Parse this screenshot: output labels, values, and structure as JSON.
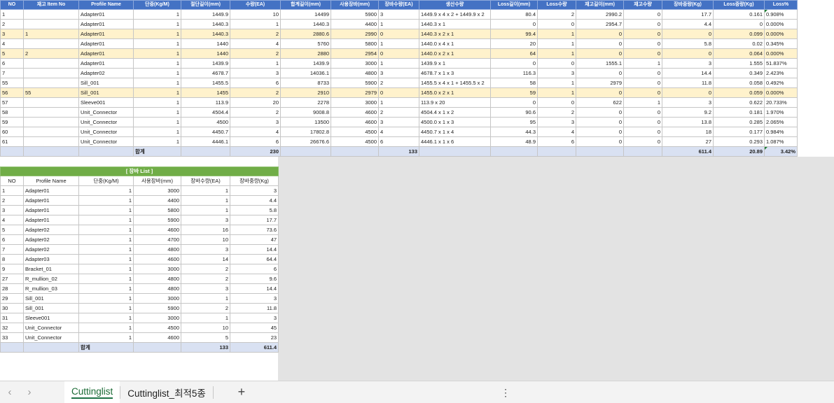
{
  "main_table": {
    "headers": [
      "NO",
      "재고 Item No",
      "Profile Name",
      "단중(Kg/M)",
      "절단길이(mm)",
      "수량(EA)",
      "합계길이(mm)",
      "사용장바(mm)",
      "장바수량(EA)",
      "생산수량",
      "Loss길이(mm)",
      "Loss수량",
      "재고길이(mm)",
      "재고수량",
      "장바중량(Kg)",
      "Loss중량(Kg)",
      "Loss%"
    ],
    "rows": [
      {
        "no": "1",
        "item": "",
        "profile": "Adapter01",
        "unit": "1",
        "cut": "1449.9",
        "qty": "10",
        "sum": "14499",
        "bar": "5900",
        "barqty": "3",
        "prod": "1449.9 x 4 x 2  +  1449.9 x 2",
        "loss": "80.4",
        "lossqty": "2",
        "stock": "2990.2",
        "stockqty": "0",
        "barw": "17.7",
        "lossw": "0.161",
        "pct": "0.908%",
        "hl": false
      },
      {
        "no": "2",
        "item": "",
        "profile": "Adapter01",
        "unit": "1",
        "cut": "1440.3",
        "qty": "1",
        "sum": "1440.3",
        "bar": "4400",
        "barqty": "1",
        "prod": "1440.3 x 1",
        "loss": "0",
        "lossqty": "0",
        "stock": "2954.7",
        "stockqty": "0",
        "barw": "4.4",
        "lossw": "0",
        "pct": "0.000%",
        "hl": false
      },
      {
        "no": "3",
        "item": "1",
        "profile": "Adapter01",
        "unit": "1",
        "cut": "1440.3",
        "qty": "2",
        "sum": "2880.6",
        "bar": "2990",
        "barqty": "0",
        "prod": "1440.3 x 2 x 1",
        "loss": "99.4",
        "lossqty": "1",
        "stock": "0",
        "stockqty": "0",
        "barw": "0",
        "lossw": "0.099",
        "pct": "0.000%",
        "hl": true
      },
      {
        "no": "4",
        "item": "",
        "profile": "Adapter01",
        "unit": "1",
        "cut": "1440",
        "qty": "4",
        "sum": "5760",
        "bar": "5800",
        "barqty": "1",
        "prod": "1440.0 x 4 x 1",
        "loss": "20",
        "lossqty": "1",
        "stock": "0",
        "stockqty": "0",
        "barw": "5.8",
        "lossw": "0.02",
        "pct": "0.345%",
        "hl": false
      },
      {
        "no": "5",
        "item": "2",
        "profile": "Adapter01",
        "unit": "1",
        "cut": "1440",
        "qty": "2",
        "sum": "2880",
        "bar": "2954",
        "barqty": "0",
        "prod": "1440.0 x 2 x 1",
        "loss": "64",
        "lossqty": "1",
        "stock": "0",
        "stockqty": "0",
        "barw": "0",
        "lossw": "0.064",
        "pct": "0.000%",
        "hl": true
      },
      {
        "no": "6",
        "item": "",
        "profile": "Adapter01",
        "unit": "1",
        "cut": "1439.9",
        "qty": "1",
        "sum": "1439.9",
        "bar": "3000",
        "barqty": "1",
        "prod": "1439.9 x 1",
        "loss": "0",
        "lossqty": "0",
        "stock": "1555.1",
        "stockqty": "1",
        "barw": "3",
        "lossw": "1.555",
        "pct": "51.837%",
        "hl": false
      },
      {
        "no": "7",
        "item": "",
        "profile": "Adapter02",
        "unit": "1",
        "cut": "4678.7",
        "qty": "3",
        "sum": "14036.1",
        "bar": "4800",
        "barqty": "3",
        "prod": "4678.7 x 1 x 3",
        "loss": "116.3",
        "lossqty": "3",
        "stock": "0",
        "stockqty": "0",
        "barw": "14.4",
        "lossw": "0.349",
        "pct": "2.423%",
        "hl": false
      },
      {
        "no": "55",
        "item": "",
        "profile": "Sill_001",
        "unit": "1",
        "cut": "1455.5",
        "qty": "6",
        "sum": "8733",
        "bar": "5900",
        "barqty": "2",
        "prod": "1455.5 x 4 x 1  +  1455.5 x 2",
        "loss": "58",
        "lossqty": "1",
        "stock": "2979",
        "stockqty": "0",
        "barw": "11.8",
        "lossw": "0.058",
        "pct": "0.492%",
        "hl": false
      },
      {
        "no": "56",
        "item": "55",
        "profile": "Sill_001",
        "unit": "1",
        "cut": "1455",
        "qty": "2",
        "sum": "2910",
        "bar": "2979",
        "barqty": "0",
        "prod": "1455.0 x 2 x 1",
        "loss": "59",
        "lossqty": "1",
        "stock": "0",
        "stockqty": "0",
        "barw": "0",
        "lossw": "0.059",
        "pct": "0.000%",
        "hl": true
      },
      {
        "no": "57",
        "item": "",
        "profile": "Sleeve001",
        "unit": "1",
        "cut": "113.9",
        "qty": "20",
        "sum": "2278",
        "bar": "3000",
        "barqty": "1",
        "prod": "113.9 x 20",
        "loss": "0",
        "lossqty": "0",
        "stock": "622",
        "stockqty": "1",
        "barw": "3",
        "lossw": "0.622",
        "pct": "20.733%",
        "hl": false
      },
      {
        "no": "58",
        "item": "",
        "profile": "Unit_Connector",
        "unit": "1",
        "cut": "4504.4",
        "qty": "2",
        "sum": "9008.8",
        "bar": "4600",
        "barqty": "2",
        "prod": "4504.4 x 1 x 2",
        "loss": "90.6",
        "lossqty": "2",
        "stock": "0",
        "stockqty": "0",
        "barw": "9.2",
        "lossw": "0.181",
        "pct": "1.970%",
        "hl": false
      },
      {
        "no": "59",
        "item": "",
        "profile": "Unit_Connector",
        "unit": "1",
        "cut": "4500",
        "qty": "3",
        "sum": "13500",
        "bar": "4600",
        "barqty": "3",
        "prod": "4500.0 x 1 x 3",
        "loss": "95",
        "lossqty": "3",
        "stock": "0",
        "stockqty": "0",
        "barw": "13.8",
        "lossw": "0.285",
        "pct": "2.065%",
        "hl": false
      },
      {
        "no": "60",
        "item": "",
        "profile": "Unit_Connector",
        "unit": "1",
        "cut": "4450.7",
        "qty": "4",
        "sum": "17802.8",
        "bar": "4500",
        "barqty": "4",
        "prod": "4450.7 x 1 x 4",
        "loss": "44.3",
        "lossqty": "4",
        "stock": "0",
        "stockqty": "0",
        "barw": "18",
        "lossw": "0.177",
        "pct": "0.984%",
        "hl": false
      },
      {
        "no": "61",
        "item": "",
        "profile": "Unit_Connector",
        "unit": "1",
        "cut": "4446.1",
        "qty": "6",
        "sum": "26676.6",
        "bar": "4500",
        "barqty": "6",
        "prod": "4446.1 x 1 x 6",
        "loss": "48.9",
        "lossqty": "6",
        "stock": "0",
        "stockqty": "0",
        "barw": "27",
        "lossw": "0.293",
        "pct": "1.087%",
        "hl": false
      }
    ],
    "total": {
      "label": "합계",
      "qty": "230",
      "barqty": "133",
      "barw": "611.4",
      "lossw": "20.89",
      "pct": "3.42%"
    }
  },
  "stock_table": {
    "title": "[ 장바 List ]",
    "headers": [
      "NO",
      "Profile Name",
      "단중(Kg/M)",
      "사용장바(mm)",
      "장바수량(EA)",
      "장바중량(Kg)"
    ],
    "rows": [
      {
        "no": "1",
        "profile": "Adapter01",
        "unit": "1",
        "bar": "3000",
        "qty": "1",
        "w": "3"
      },
      {
        "no": "2",
        "profile": "Adapter01",
        "unit": "1",
        "bar": "4400",
        "qty": "1",
        "w": "4.4"
      },
      {
        "no": "3",
        "profile": "Adapter01",
        "unit": "1",
        "bar": "5800",
        "qty": "1",
        "w": "5.8"
      },
      {
        "no": "4",
        "profile": "Adapter01",
        "unit": "1",
        "bar": "5900",
        "qty": "3",
        "w": "17.7"
      },
      {
        "no": "5",
        "profile": "Adapter02",
        "unit": "1",
        "bar": "4600",
        "qty": "16",
        "w": "73.6"
      },
      {
        "no": "6",
        "profile": "Adapter02",
        "unit": "1",
        "bar": "4700",
        "qty": "10",
        "w": "47"
      },
      {
        "no": "7",
        "profile": "Adapter02",
        "unit": "1",
        "bar": "4800",
        "qty": "3",
        "w": "14.4"
      },
      {
        "no": "8",
        "profile": "Adapter03",
        "unit": "1",
        "bar": "4600",
        "qty": "14",
        "w": "64.4"
      },
      {
        "no": "9",
        "profile": "Bracket_01",
        "unit": "1",
        "bar": "3000",
        "qty": "2",
        "w": "6"
      },
      {
        "no": "27",
        "profile": "R_mullion_02",
        "unit": "1",
        "bar": "4800",
        "qty": "2",
        "w": "9.6"
      },
      {
        "no": "28",
        "profile": "R_mullion_03",
        "unit": "1",
        "bar": "4800",
        "qty": "3",
        "w": "14.4"
      },
      {
        "no": "29",
        "profile": "Sill_001",
        "unit": "1",
        "bar": "3000",
        "qty": "1",
        "w": "3"
      },
      {
        "no": "30",
        "profile": "Sill_001",
        "unit": "1",
        "bar": "5900",
        "qty": "2",
        "w": "11.8"
      },
      {
        "no": "31",
        "profile": "Sleeve001",
        "unit": "1",
        "bar": "3000",
        "qty": "1",
        "w": "3"
      },
      {
        "no": "32",
        "profile": "Unit_Connector",
        "unit": "1",
        "bar": "4500",
        "qty": "10",
        "w": "45"
      },
      {
        "no": "33",
        "profile": "Unit_Connector",
        "unit": "1",
        "bar": "4600",
        "qty": "5",
        "w": "23"
      }
    ],
    "total": {
      "label": "합계",
      "qty": "133",
      "w": "611.4"
    }
  },
  "tabs": {
    "prev_icon": "‹",
    "next_icon": "›",
    "items": [
      "Cuttinglist",
      "Cuttinglist_최적5종"
    ],
    "add_icon": "+",
    "more_icon": "⋮"
  },
  "colors": {
    "main_header": "#4472c4",
    "stock_title": "#70ad47",
    "stock_header": "#a9d08e",
    "highlight_row": "#fff2cc",
    "total_row": "#d9e1f2",
    "active_tab_text": "#1b6b35"
  }
}
